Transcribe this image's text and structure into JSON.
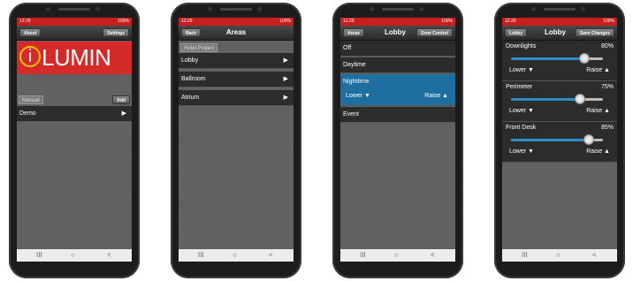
{
  "status": {
    "time": "12:29",
    "icons": "100%"
  },
  "screens": [
    {
      "left_button": "About",
      "right_button": "Settings",
      "logo": {
        "i": "i",
        "text": "LUMIN"
      },
      "section_label": "Manual",
      "add_button": "Add",
      "items": [
        {
          "label": "Demo",
          "arrow": "▶"
        }
      ]
    },
    {
      "left_button": "Back",
      "title": "Areas",
      "section_label": "Hotel Project",
      "items": [
        {
          "label": "Lobby",
          "arrow": "▶"
        },
        {
          "label": "Ballroom",
          "arrow": "▶"
        },
        {
          "label": "Atrium",
          "arrow": "▶"
        }
      ]
    },
    {
      "left_button": "Areas",
      "title": "Lobby",
      "right_button": "Zone Control",
      "scenes": [
        "Off",
        "Daytime",
        "Nighttime",
        "Event"
      ],
      "active_scene": "Nighttime",
      "lower_label": "Lower ▼",
      "raise_label": "Raise ▲"
    },
    {
      "left_button": "Lobby",
      "title": "Lobby",
      "right_button": "Save Changes",
      "zones": [
        {
          "name": "Downlights",
          "percent": "80%",
          "level": 0.8,
          "lower": "Lower ▼",
          "raise": "Raise ▲"
        },
        {
          "name": "Perimeter",
          "percent": "75%",
          "level": 0.75,
          "lower": "Lower ▼",
          "raise": "Raise ▲"
        },
        {
          "name": "Front Desk",
          "percent": "85%",
          "level": 0.85,
          "lower": "Lower ▼",
          "raise": "Raise ▲"
        }
      ]
    }
  ],
  "nav": {
    "recents": "III",
    "home": "○",
    "back": "<"
  },
  "colors": {
    "status_bar": "#c81e1e",
    "logo_bg": "#d42a2a",
    "accent": "#1e6fa0",
    "slider_fill": "#2e8bc9"
  }
}
